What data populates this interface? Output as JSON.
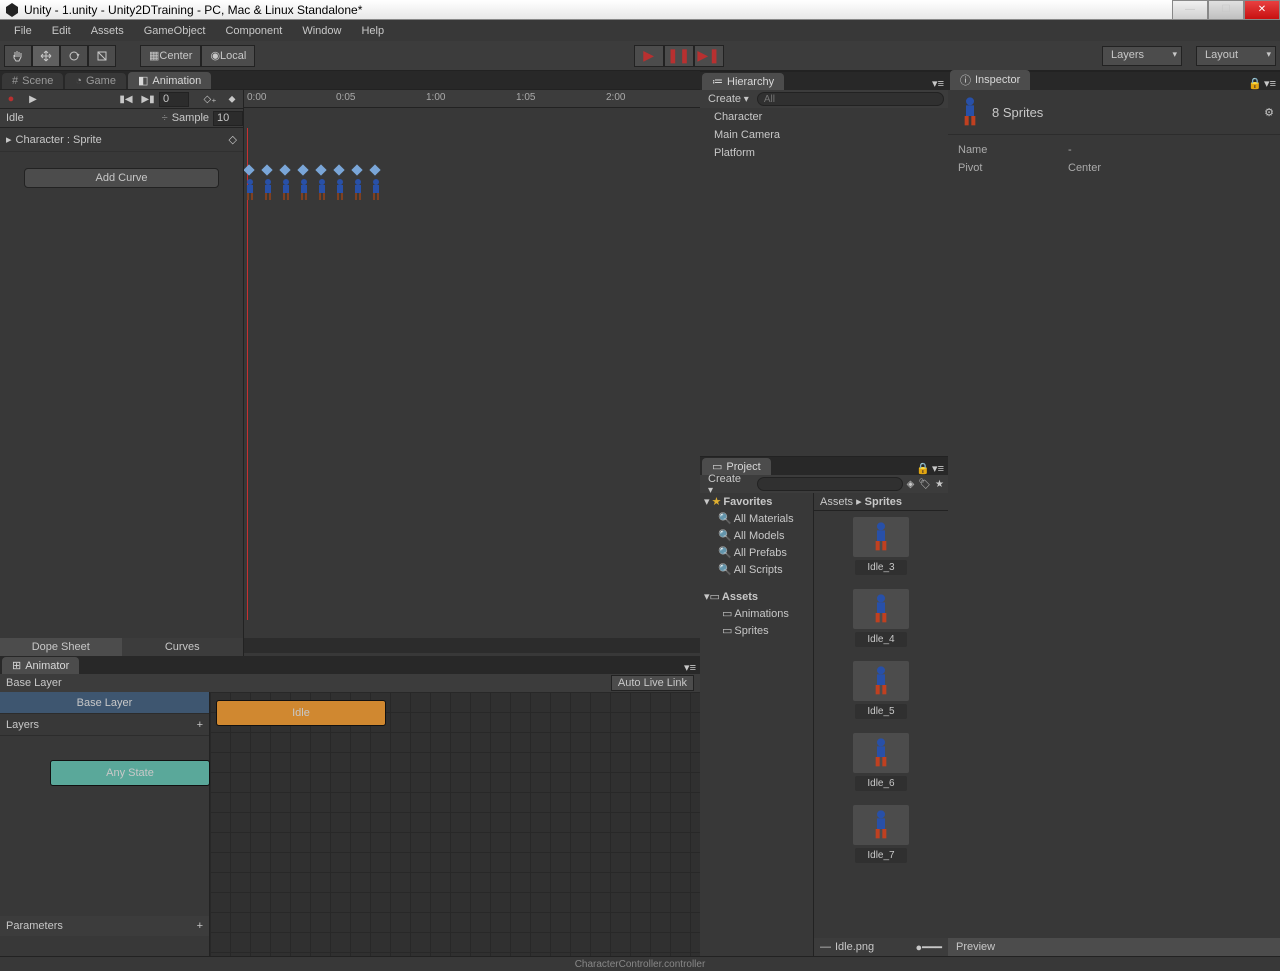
{
  "window": {
    "title": "Unity - 1.unity - Unity2DTraining - PC, Mac & Linux Standalone*"
  },
  "menu": [
    "File",
    "Edit",
    "Assets",
    "GameObject",
    "Component",
    "Window",
    "Help"
  ],
  "toolbar": {
    "pivot": "Center",
    "space": "Local",
    "layers": "Layers",
    "layout": "Layout"
  },
  "tabs": {
    "scene": "Scene",
    "game": "Game",
    "animation": "Animation",
    "hierarchy": "Hierarchy",
    "project": "Project",
    "inspector": "Inspector",
    "animator": "Animator"
  },
  "animation": {
    "frame": "0",
    "clip": "Idle",
    "sample_label": "Sample",
    "sample_value": "10",
    "property": "Character : Sprite",
    "add_curve": "Add Curve",
    "time_ticks": [
      "0:00",
      "0:05",
      "1:00",
      "1:05",
      "2:00"
    ],
    "dope": "Dope Sheet",
    "curves": "Curves",
    "keyframe_count": 8
  },
  "animator": {
    "breadcrumb": "Base Layer",
    "auto_live": "Auto Live Link",
    "layer": "Base Layer",
    "layers_label": "Layers",
    "idle_node": "Idle",
    "anystate_node": "Any State",
    "parameters": "Parameters"
  },
  "hierarchy": {
    "create": "Create",
    "search_placeholder": "All",
    "items": [
      "Character",
      "Main Camera",
      "Platform"
    ]
  },
  "project": {
    "create": "Create",
    "favorites": "Favorites",
    "fav_items": [
      "All Materials",
      "All Models",
      "All Prefabs",
      "All Scripts"
    ],
    "assets": "Assets",
    "asset_folders": [
      "Animations",
      "Sprites"
    ],
    "breadcrumb_root": "Assets",
    "breadcrumb_leaf": "Sprites",
    "sprites": [
      "Idle_3",
      "Idle_4",
      "Idle_5",
      "Idle_6",
      "Idle_7"
    ],
    "footer": "Idle.png"
  },
  "inspector": {
    "title": "8 Sprites",
    "name_label": "Name",
    "name_value": "-",
    "pivot_label": "Pivot",
    "pivot_value": "Center",
    "preview": "Preview"
  },
  "status": "CharacterController.controller"
}
